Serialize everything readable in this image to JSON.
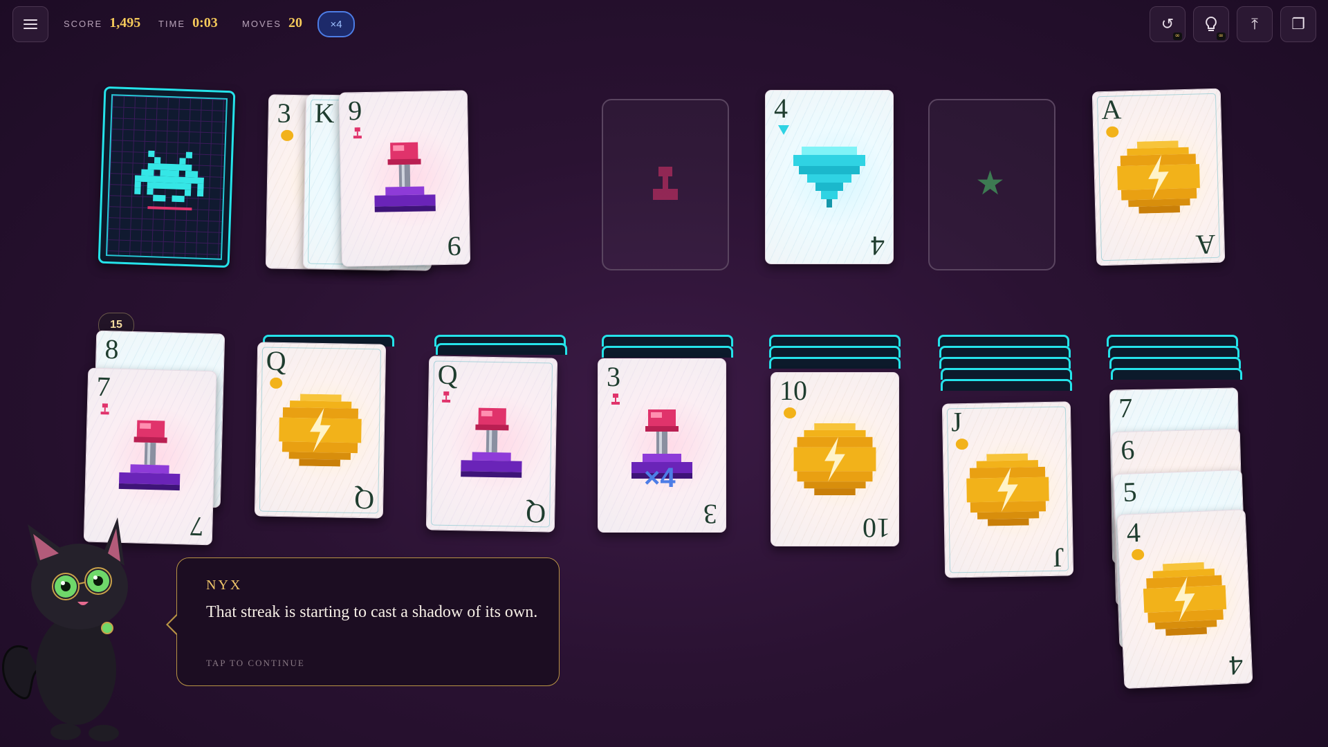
{
  "topbar": {
    "score_label": "SCORE",
    "score_value": "1,495",
    "time_label": "TIME",
    "time_value": "0:03",
    "moves_label": "MOVES",
    "moves_value": "20",
    "multiplier": "×4",
    "tools": [
      {
        "name": "undo-icon",
        "glyph": "↺",
        "badge": "∞"
      },
      {
        "name": "hint-icon",
        "glyph": "💡",
        "badge": "∞"
      },
      {
        "name": "auto-complete-icon",
        "glyph": "⤒",
        "badge": ""
      },
      {
        "name": "copy-icon",
        "glyph": "❐",
        "badge": ""
      }
    ]
  },
  "stock": {
    "remaining_badge": "15"
  },
  "waste": [
    {
      "rank": "3",
      "suit": "coin"
    },
    {
      "rank": "K",
      "suit": "plunger"
    },
    {
      "rank": "9",
      "suit": "plunger"
    }
  ],
  "foundations": [
    {
      "suit": "plunger",
      "rank": ""
    },
    {
      "suit": "gem",
      "rank": "4"
    },
    {
      "suit": "star",
      "rank": ""
    },
    {
      "suit": "coin",
      "rank": "A"
    }
  ],
  "tableau": [
    {
      "cards": [
        {
          "rank": "8",
          "suit": "gem"
        },
        {
          "rank": "7",
          "suit": "plunger"
        }
      ]
    },
    {
      "cards": [
        {
          "rank": "Q",
          "suit": "coin"
        }
      ]
    },
    {
      "cards": [
        {
          "rank": "Q",
          "suit": "plunger"
        }
      ]
    },
    {
      "cards": [
        {
          "rank": "3",
          "suit": "plunger",
          "overlay": "×4"
        }
      ]
    },
    {
      "cards": [
        {
          "rank": "10",
          "suit": "coin"
        }
      ]
    },
    {
      "cards": [
        {
          "rank": "J",
          "suit": "coin"
        }
      ]
    },
    {
      "cards": [
        {
          "rank": "7",
          "suit": "gem"
        },
        {
          "rank": "6",
          "suit": "coin"
        },
        {
          "rank": "5",
          "suit": "gem"
        },
        {
          "rank": "4",
          "suit": "coin"
        }
      ]
    }
  ],
  "dialog": {
    "speaker": "NYX",
    "text": "That streak is starting to cast a shadow of its own.",
    "prompt": "TAP TO CONTINUE"
  },
  "colors": {
    "accent_gold": "#f4c95a",
    "multiplier_blue": "#4d7de6",
    "card_back_teal": "#25e3ea",
    "coin": "#f2b21a",
    "plunger": "#e0336b",
    "gem": "#2fd3e3"
  }
}
